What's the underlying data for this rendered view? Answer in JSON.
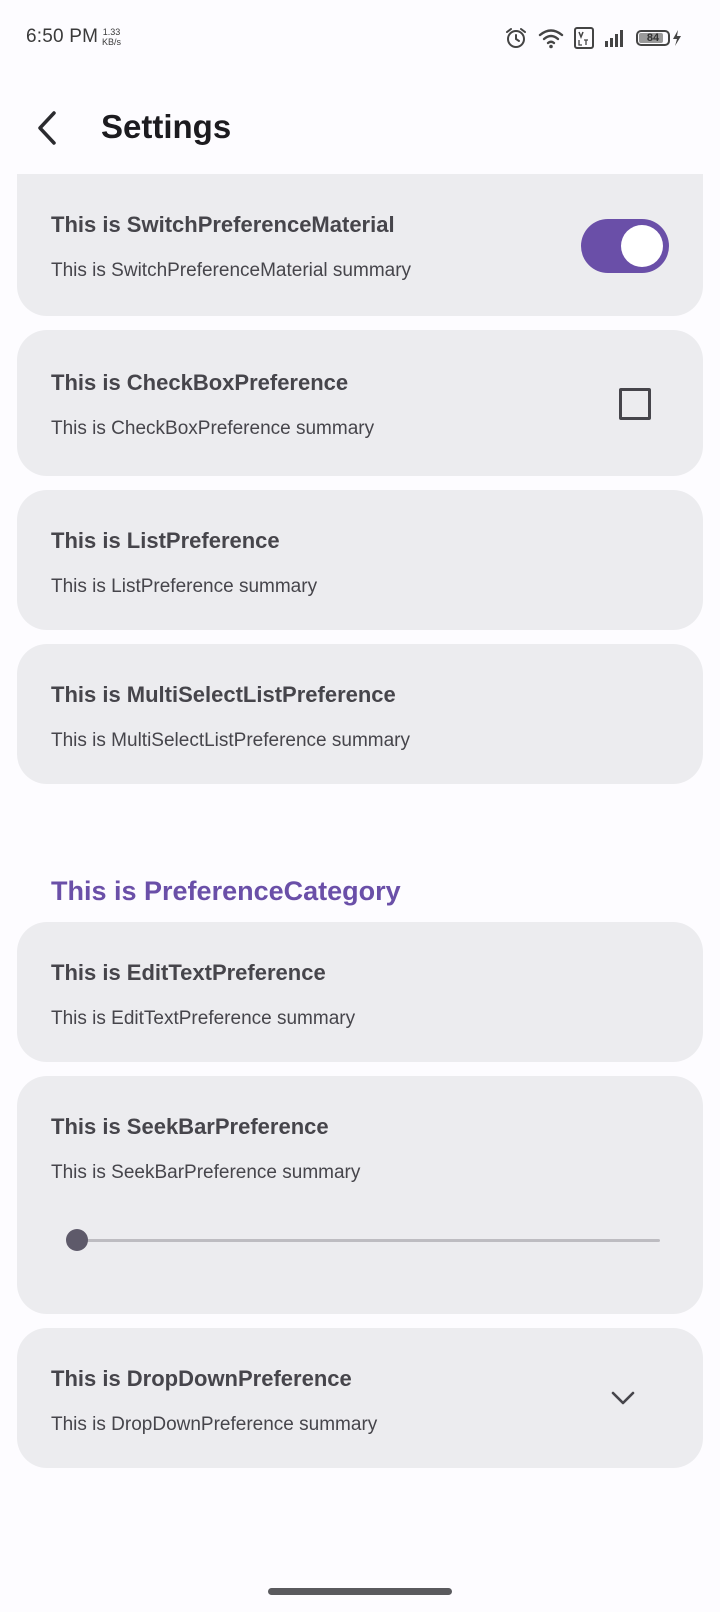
{
  "status_bar": {
    "time": "6:50 PM",
    "net_speed_value": "1.33",
    "net_speed_unit": "KB/s",
    "battery_level": "84",
    "icons": [
      "alarm-icon",
      "wifi-icon",
      "volte-icon",
      "signal-icon",
      "battery-icon",
      "charging-icon"
    ]
  },
  "app_bar": {
    "title": "Settings",
    "back_icon": "back-arrow-icon"
  },
  "preferences": {
    "switch": {
      "title": "This is SwitchPreferenceMaterial",
      "summary": "This is SwitchPreferenceMaterial summary",
      "checked": true
    },
    "checkbox": {
      "title": "This is CheckBoxPreference",
      "summary": "This is CheckBoxPreference summary",
      "checked": false
    },
    "list": {
      "title": "This is ListPreference",
      "summary": "This is ListPreference summary"
    },
    "multi_select": {
      "title": "This is MultiSelectListPreference",
      "summary": "This is MultiSelectListPreference summary"
    },
    "category": {
      "title": "This is PreferenceCategory"
    },
    "edit_text": {
      "title": "This is EditTextPreference",
      "summary": "This is EditTextPreference summary"
    },
    "seekbar": {
      "title": "This is SeekBarPreference",
      "summary": "This is SeekBarPreference summary",
      "value_fraction": 0.0
    },
    "dropdown": {
      "title": "This is DropDownPreference",
      "summary": "This is DropDownPreference summary",
      "icon": "chevron-down-icon"
    }
  },
  "colors": {
    "accent": "#6a4fa8",
    "card_background": "#ececef",
    "page_background": "#fdfcff",
    "text": "#46454b"
  }
}
